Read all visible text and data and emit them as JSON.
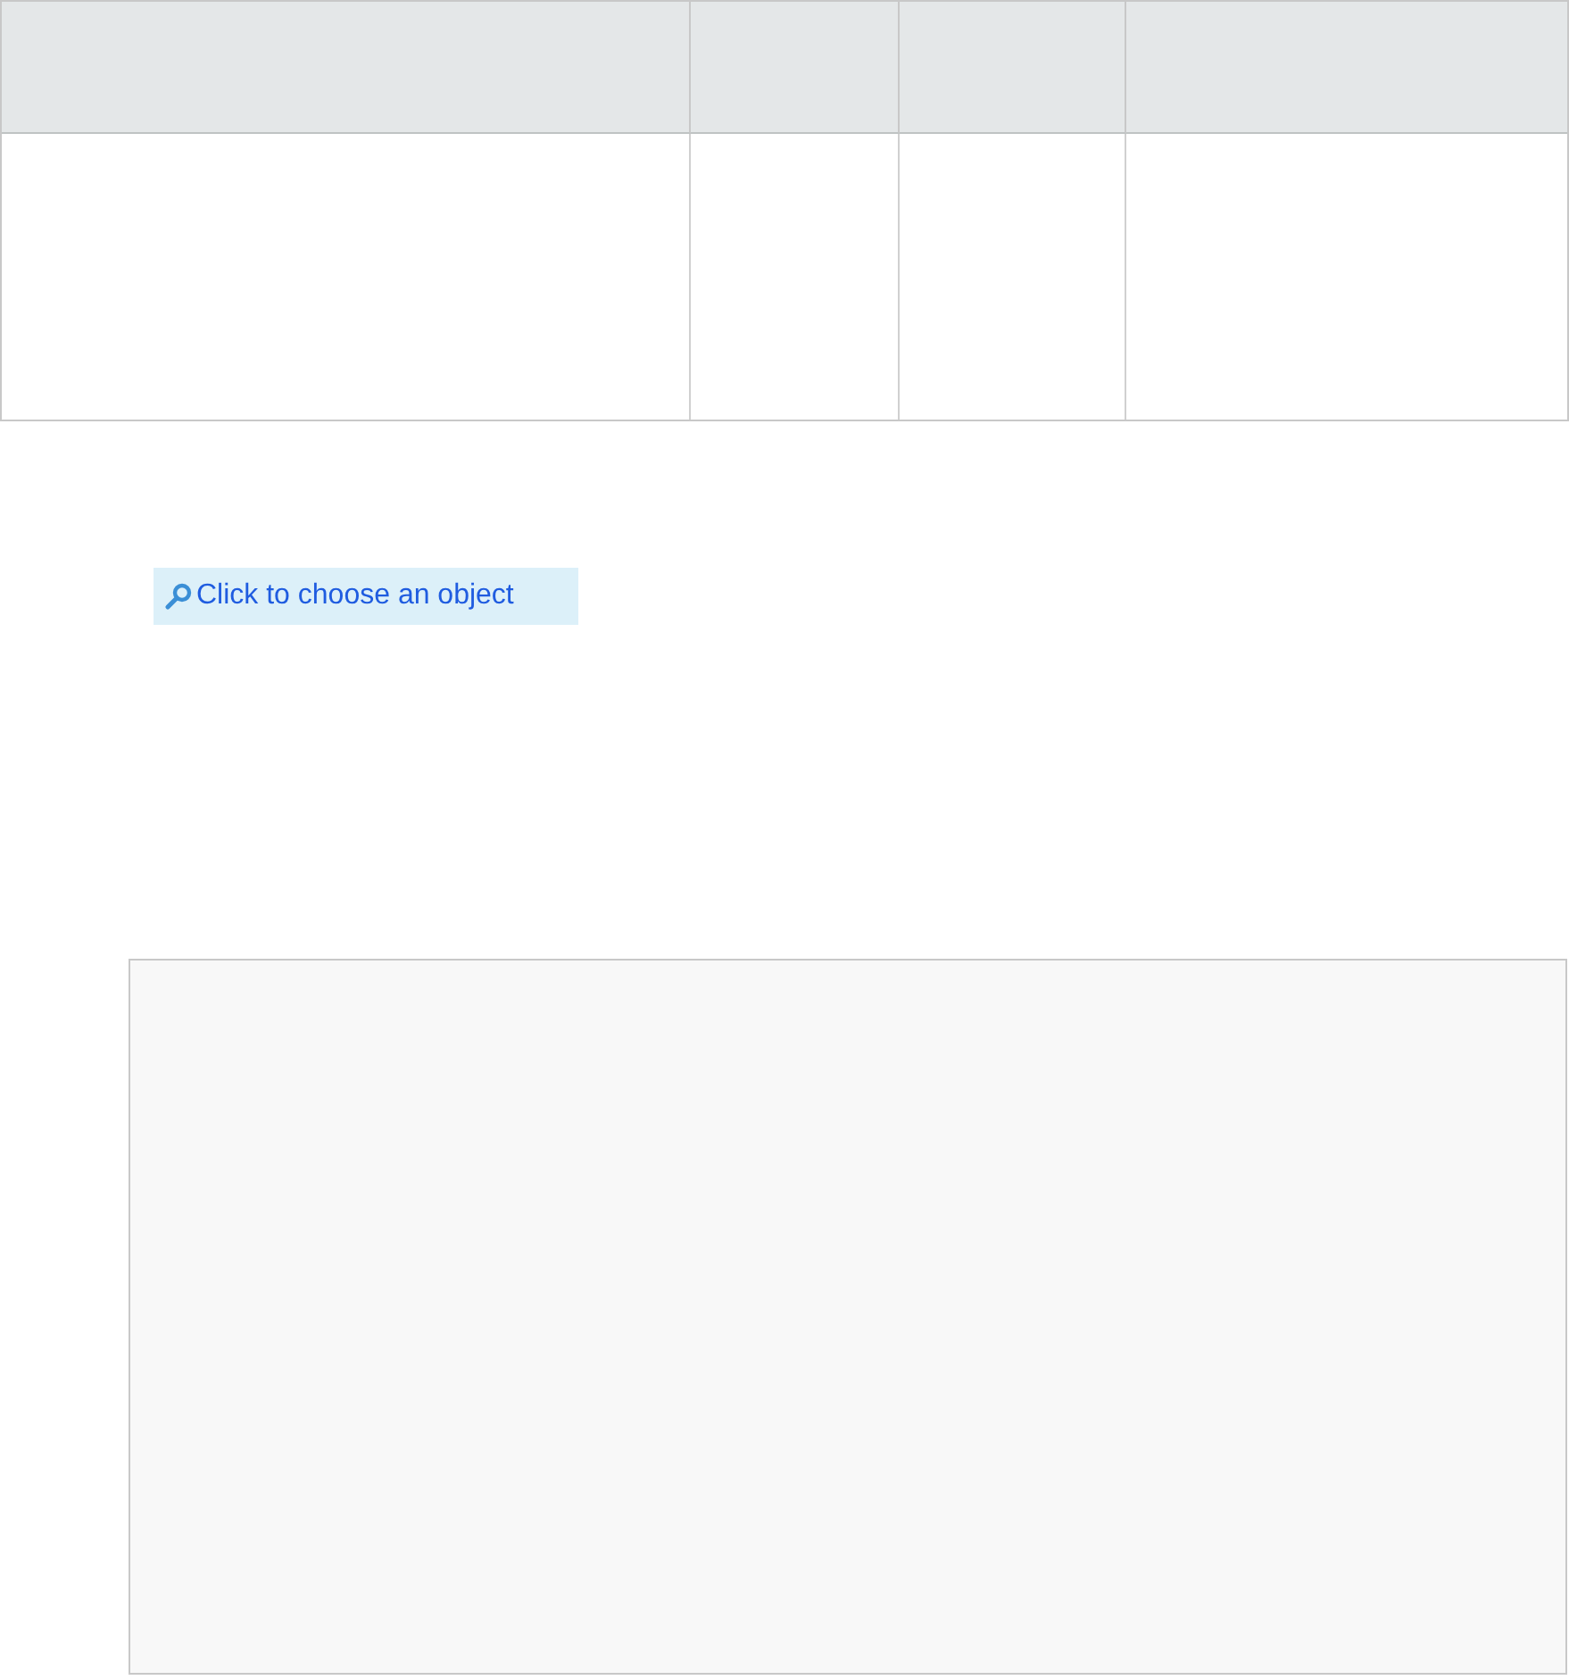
{
  "object_picker": {
    "label": "Click to choose an object"
  }
}
